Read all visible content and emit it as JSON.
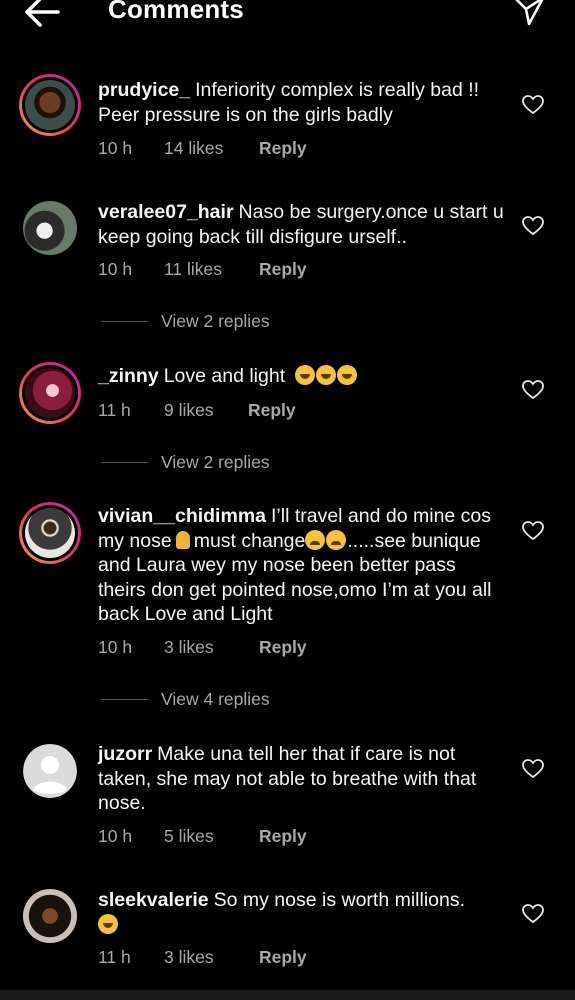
{
  "header": {
    "title": "Comments",
    "back_icon": "arrow-left-icon",
    "share_icon": "paper-plane-icon"
  },
  "colors": {
    "background": "#000000",
    "primary_text": "#f5f5f5",
    "secondary_text": "#a8a8a8",
    "story_ring": "#e5305e"
  },
  "comments": [
    {
      "username": "prudyice_",
      "text": "Inferiority complex is really bad !! Peer pressure is on the girls badly",
      "time": "10 h",
      "likes": "14 likes",
      "reply": "Reply"
    },
    {
      "username": "veralee07_hair",
      "text": "Naso be surgery.once u start u keep going back till disfigure urself..",
      "time": "10 h",
      "likes": "11 likes",
      "reply": "Reply",
      "view_replies": "View 2 replies"
    },
    {
      "username": "_zinny",
      "text": "Love and light",
      "emojis": "😂😂😂",
      "time": "11 h",
      "likes": "9 likes",
      "reply": "Reply",
      "view_replies": "View 2 replies"
    },
    {
      "username": "vivian__chidimma",
      "text_part1": "I’ll travel and do mine cos my nose",
      "text_part2": "must change",
      "text_part3": ".....see bunique and Laura wey my nose been better pass theirs don get pointed nose,omo I’m at you all back Love and Light",
      "time": "10 h",
      "likes": "3 likes",
      "reply": "Reply",
      "view_replies": "View 4 replies"
    },
    {
      "username": "juzorr",
      "text": "Make una tell her that if care is not taken, she may not able to breathe with that nose.",
      "time": "10 h",
      "likes": "5 likes",
      "reply": "Reply"
    },
    {
      "username": "sleekvalerie",
      "text": "So my nose is worth millions.",
      "emojis": "😂",
      "time": "11 h",
      "likes": "3 likes",
      "reply": "Reply"
    }
  ]
}
